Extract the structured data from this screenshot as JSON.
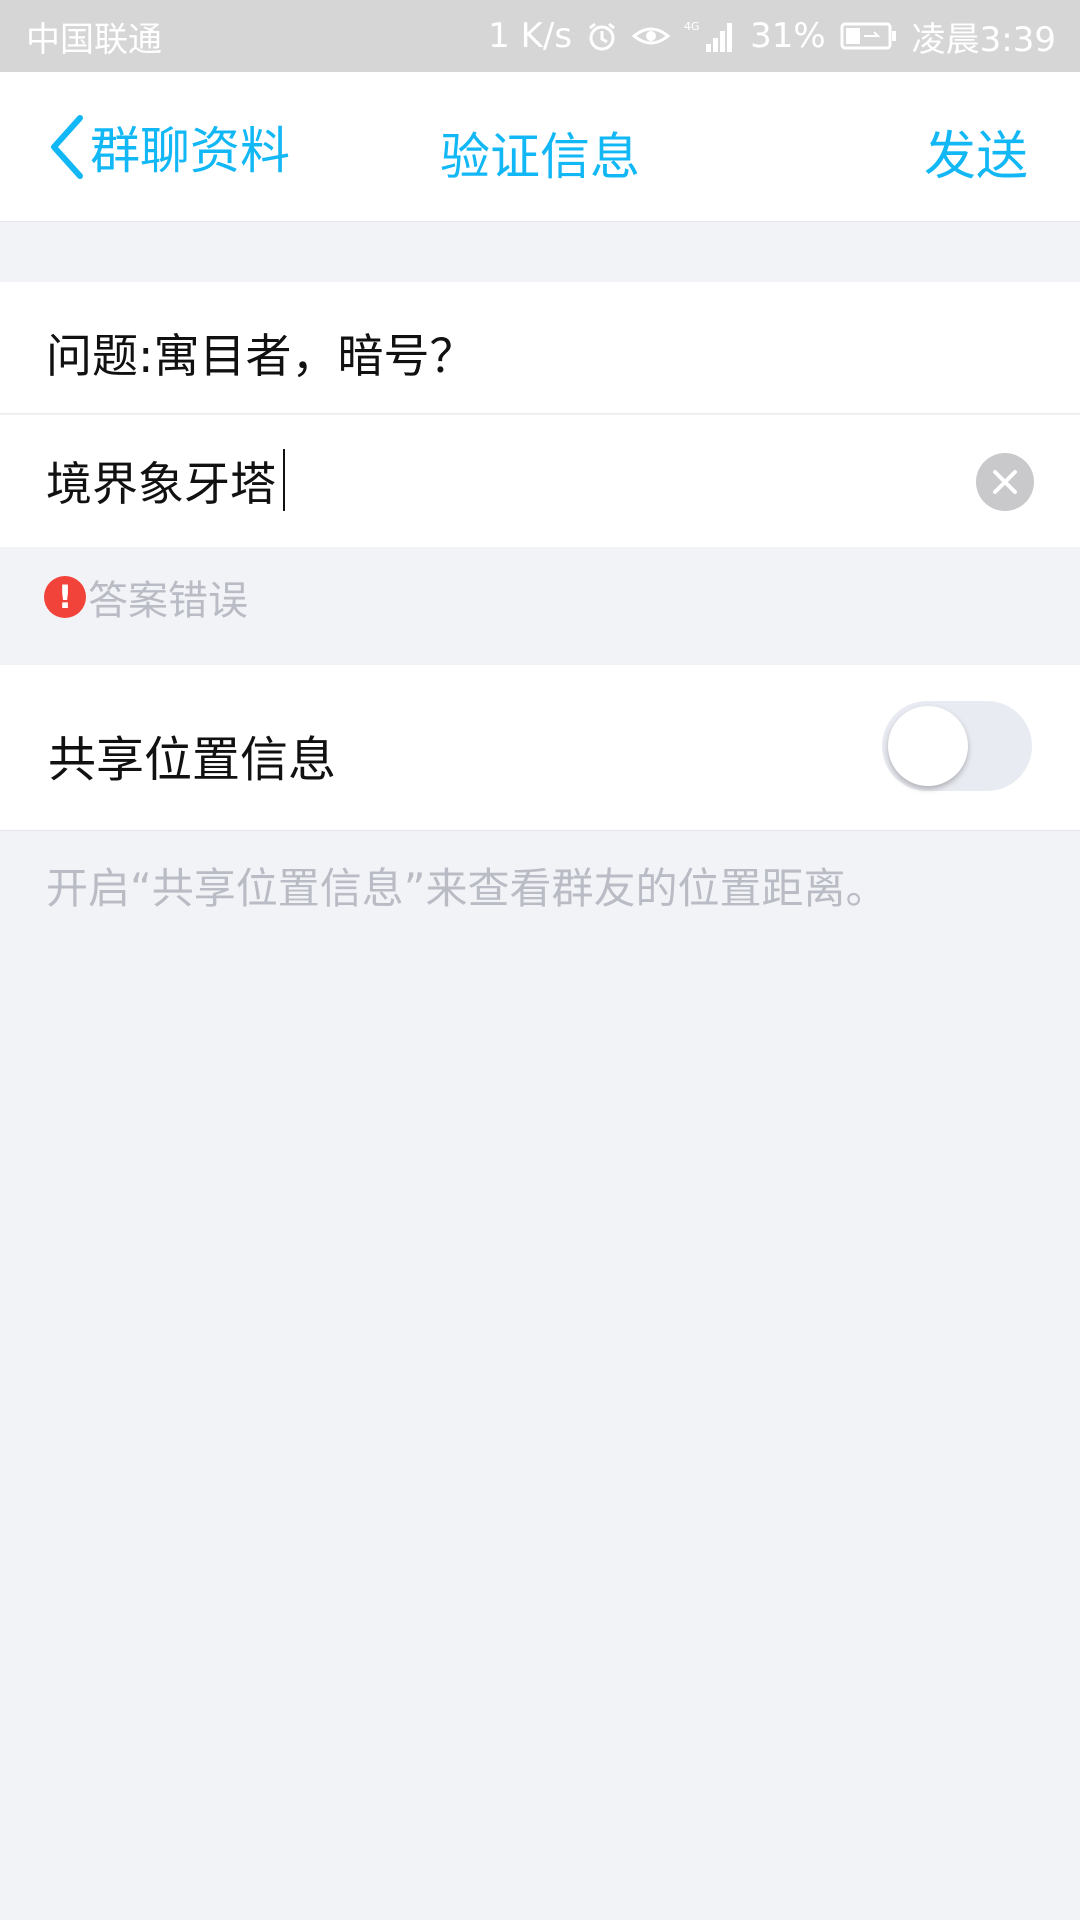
{
  "status_bar": {
    "carrier": "中国联通",
    "speed": "1 K/s",
    "network": "4G",
    "battery": "31%",
    "time": "凌晨3:39"
  },
  "nav": {
    "back_label": "群聊资料",
    "title": "验证信息",
    "send_label": "发送"
  },
  "question": {
    "text": "问题:寓目者，暗号？"
  },
  "answer": {
    "value": "境界象牙塔"
  },
  "error": {
    "icon": "!",
    "text": "答案错误"
  },
  "share_location": {
    "label": "共享位置信息",
    "enabled": false
  },
  "hint": "开启“共享位置信息”来查看群友的位置距离。",
  "colors": {
    "accent": "#12b7f5",
    "error": "#f2433a",
    "background": "#f2f3f7"
  }
}
